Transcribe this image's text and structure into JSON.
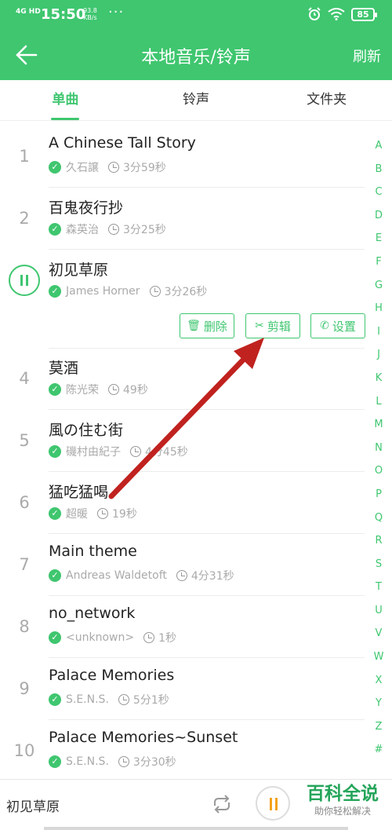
{
  "status_bar": {
    "network": "4G HD",
    "time": "15:50",
    "speed_value": "93.8",
    "speed_unit": "KB/s",
    "more": "···",
    "battery": "85"
  },
  "header": {
    "title": "本地音乐/铃声",
    "refresh_label": "刷新"
  },
  "tabs": [
    "单曲",
    "铃声",
    "文件夹"
  ],
  "songs": [
    {
      "num": "1",
      "title": "A Chinese Tall Story",
      "artist": "久石譲",
      "duration": "3分59秒"
    },
    {
      "num": "2",
      "title": "百鬼夜行抄",
      "artist": "森英治",
      "duration": "3分25秒"
    },
    {
      "num": "",
      "title": "初见草原",
      "artist": "James Horner",
      "duration": "3分26秒"
    },
    {
      "num": "4",
      "title": "莫酒",
      "artist": "陈光荣",
      "duration": "49秒"
    },
    {
      "num": "5",
      "title": "風の住む街",
      "artist": "磯村由紀子",
      "duration": "4分45秒"
    },
    {
      "num": "6",
      "title": "猛吃猛喝",
      "artist": "超暖",
      "duration": "19秒"
    },
    {
      "num": "7",
      "title": "Main theme",
      "artist": "Andreas Waldetoft",
      "duration": "4分31秒"
    },
    {
      "num": "8",
      "title": "no_network",
      "artist": "<unknown>",
      "duration": "1秒"
    },
    {
      "num": "9",
      "title": "Palace Memories",
      "artist": "S.E.N.S.",
      "duration": "5分1秒"
    },
    {
      "num": "10",
      "title": "Palace Memories~Sunset",
      "artist": "S.E.N.S.",
      "duration": "3分30秒"
    }
  ],
  "row_actions": {
    "delete_label": "删除",
    "edit_label": "剪辑",
    "set_label": "设置"
  },
  "index_letters": [
    "A",
    "B",
    "C",
    "D",
    "E",
    "F",
    "G",
    "H",
    "I",
    "J",
    "K",
    "L",
    "M",
    "N",
    "O",
    "P",
    "Q",
    "R",
    "S",
    "T",
    "U",
    "V",
    "W",
    "X",
    "Y",
    "Z",
    "#"
  ],
  "player": {
    "now_playing": "初见草原"
  },
  "watermark": {
    "name": "百科全说",
    "slogan": "助你轻松解决"
  },
  "colors": {
    "accent": "#3fc66f",
    "annotation_arrow": "#c0221f",
    "pause_icon": "#f4a21b"
  }
}
